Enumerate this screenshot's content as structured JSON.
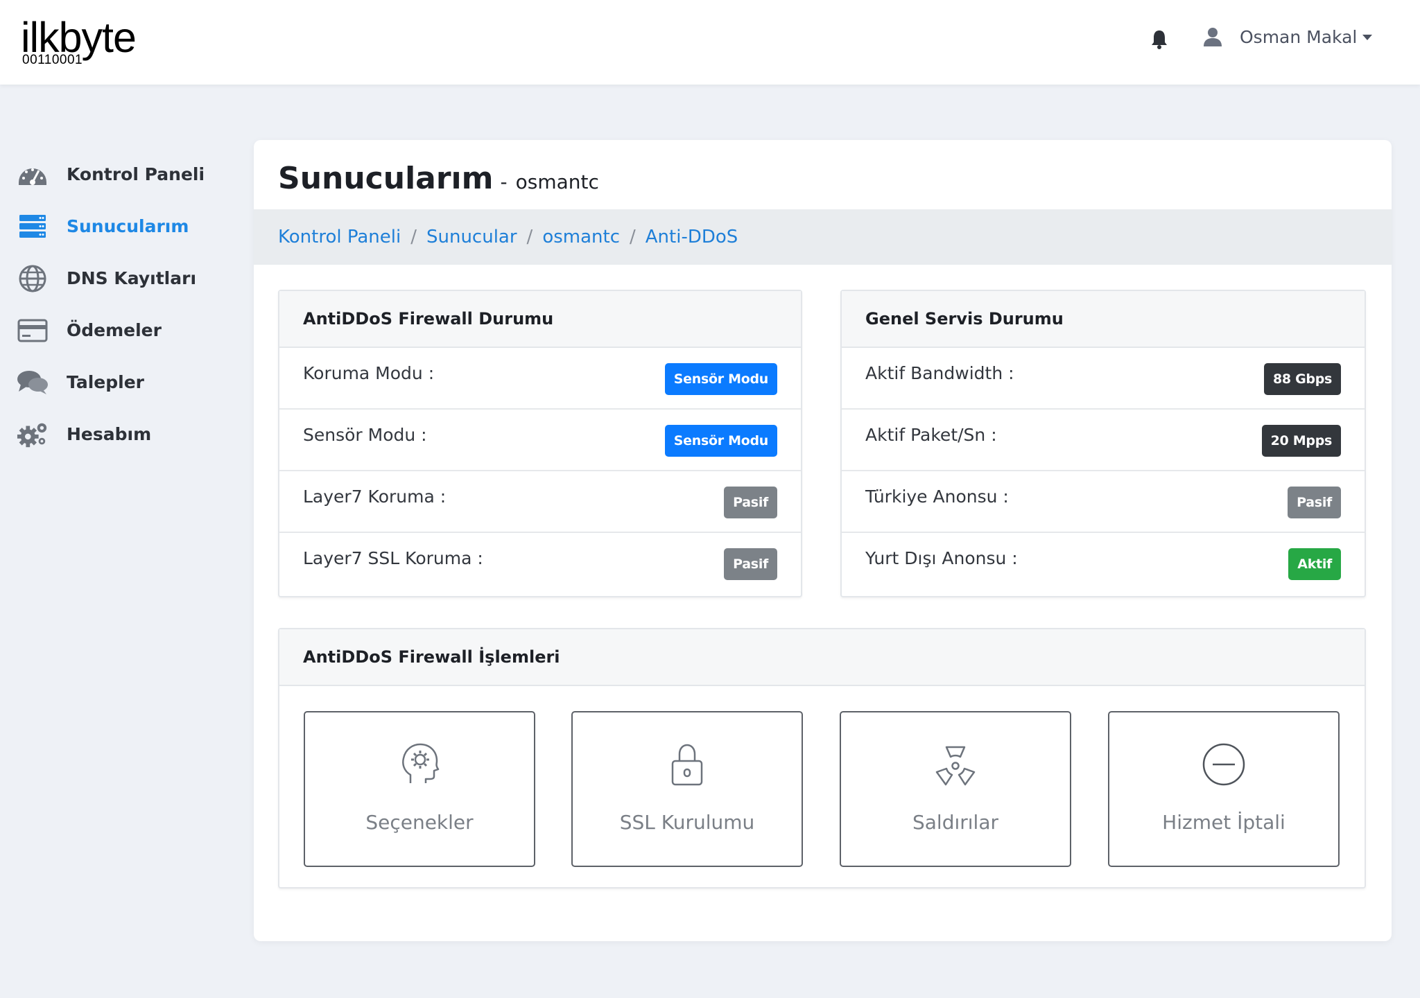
{
  "brand": {
    "name": "ilkbyte",
    "tagline": "00110001"
  },
  "header": {
    "user_name": "Osman Makal"
  },
  "sidebar": {
    "items": [
      {
        "label": "Kontrol Paneli",
        "icon": "dashboard-icon",
        "active": false
      },
      {
        "label": "Sunucularım",
        "icon": "server-icon",
        "active": true
      },
      {
        "label": "DNS Kayıtları",
        "icon": "globe-icon",
        "active": false
      },
      {
        "label": "Ödemeler",
        "icon": "credit-card-icon",
        "active": false
      },
      {
        "label": "Talepler",
        "icon": "chat-icon",
        "active": false
      },
      {
        "label": "Hesabım",
        "icon": "gears-icon",
        "active": false
      }
    ]
  },
  "page": {
    "title": "Sunucularım",
    "separator": "-",
    "subtitle": "osmantc"
  },
  "breadcrumb": [
    "Kontrol Paneli",
    "Sunucular",
    "osmantc",
    "Anti-DDoS"
  ],
  "firewall_status": {
    "title": "AntiDDoS Firewall Durumu",
    "rows": [
      {
        "label": "Koruma Modu :",
        "badge": "Sensör Modu",
        "color": "#0b7bff"
      },
      {
        "label": "Sensör Modu :",
        "badge": "Sensör Modu",
        "color": "#0b7bff"
      },
      {
        "label": "Layer7 Koruma :",
        "badge": "Pasif",
        "color": "#7c8288"
      },
      {
        "label": "Layer7 SSL Koruma :",
        "badge": "Pasif",
        "color": "#7c8288"
      }
    ]
  },
  "service_status": {
    "title": "Genel Servis Durumu",
    "rows": [
      {
        "label": "Aktif Bandwidth :",
        "badge": "88 Gbps",
        "color": "#33373c"
      },
      {
        "label": "Aktif Paket/Sn :",
        "badge": "20 Mpps",
        "color": "#33373c"
      },
      {
        "label": "Türkiye Anonsu :",
        "badge": "Pasif",
        "color": "#7c8288"
      },
      {
        "label": "Yurt Dışı Anonsu :",
        "badge": "Aktif",
        "color": "#27a845"
      }
    ]
  },
  "operations": {
    "title": "AntiDDoS Firewall İşlemleri",
    "items": [
      {
        "label": "Seçenekler",
        "icon": "head-gear-icon"
      },
      {
        "label": "SSL Kurulumu",
        "icon": "lock-icon"
      },
      {
        "label": "Saldırılar",
        "icon": "radiation-icon"
      },
      {
        "label": "Hizmet İptali",
        "icon": "minus-circle-icon"
      }
    ]
  },
  "colors": {
    "accent": "#1e88e5",
    "link": "#1e7fd8",
    "background": "#eef1f6"
  }
}
